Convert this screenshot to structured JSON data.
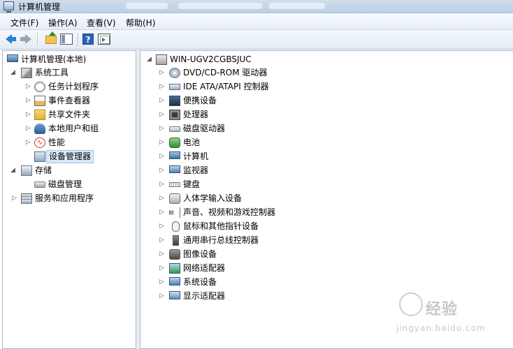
{
  "window": {
    "title": "计算机管理",
    "blurred_segments": 3
  },
  "menubar": {
    "items": [
      "文件(F)",
      "操作(A)",
      "查看(V)",
      "帮助(H)"
    ]
  },
  "toolbar": {
    "buttons": [
      "back-icon",
      "forward-icon",
      "up-folder-icon",
      "show-console-tree-icon",
      "help-icon",
      "show-action-pane-icon"
    ]
  },
  "tree": {
    "root": "计算机管理(本地)",
    "system_tools": "系统工具",
    "task_scheduler": "任务计划程序",
    "event_viewer": "事件查看器",
    "shared_folders": "共享文件夹",
    "local_users": "本地用户和组",
    "performance": "性能",
    "device_manager": "设备管理器",
    "storage": "存储",
    "disk_management": "磁盘管理",
    "services_apps": "服务和应用程序",
    "selected": "设备管理器"
  },
  "devices": {
    "computer_name": "WIN-UGV2CGBSJUC",
    "categories": [
      "DVD/CD-ROM 驱动器",
      "IDE ATA/ATAPI 控制器",
      "便携设备",
      "处理器",
      "磁盘驱动器",
      "电池",
      "计算机",
      "监视器",
      "键盘",
      "人体学输入设备",
      "声音、视频和游戏控制器",
      "鼠标和其他指针设备",
      "通用串行总线控制器",
      "图像设备",
      "网络适配器",
      "系统设备",
      "显示适配器"
    ]
  },
  "watermark": {
    "brand": "经验",
    "url": "jingyan.baidu.com"
  },
  "colors": {
    "selection": "#dbeaf9",
    "selection_border": "#9ec4ea",
    "back_arrow": "#2e7fd0"
  }
}
